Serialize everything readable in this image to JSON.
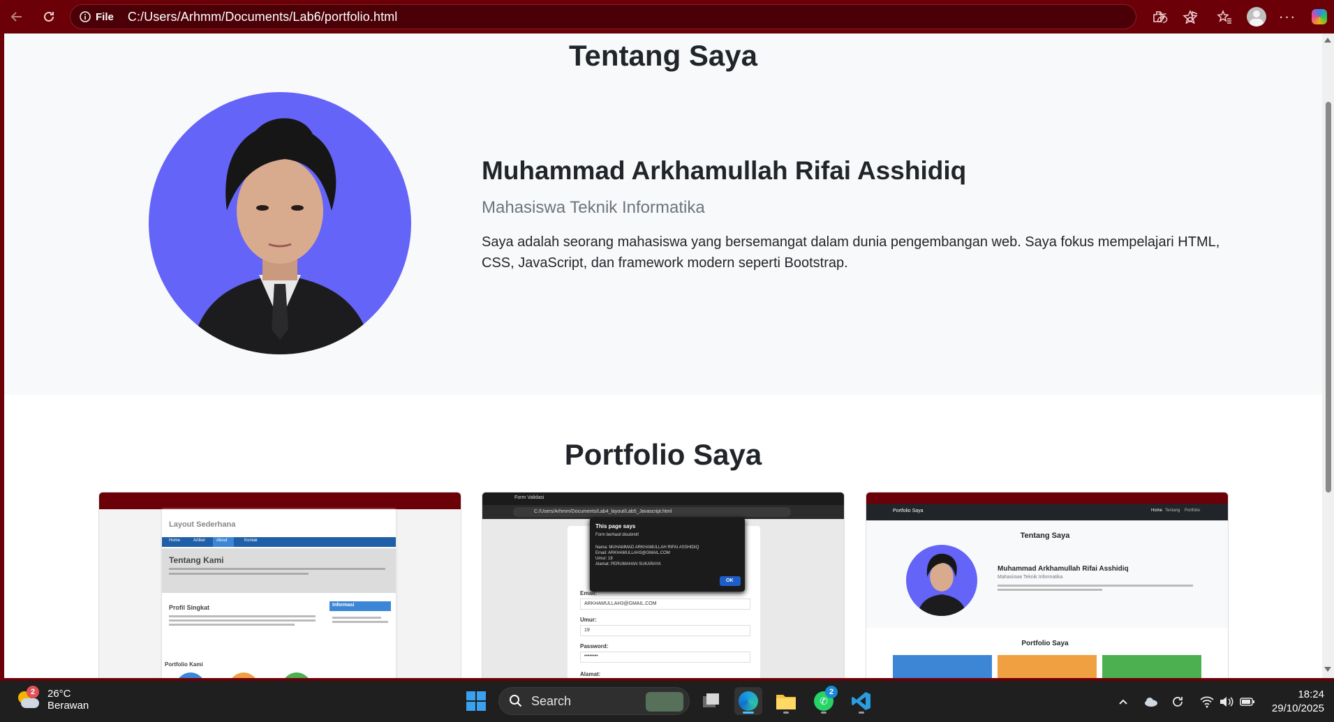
{
  "browser": {
    "site_info": "File",
    "url": "C:/Users/Arhmm/Documents/Lab6/portfolio.html"
  },
  "about": {
    "title": "Tentang Saya",
    "name": "Muhammad Arkhamullah Rifai Asshidiq",
    "role": "Mahasiswa Teknik Informatika",
    "description": "Saya adalah seorang mahasiswa yang bersemangat dalam dunia pengembangan web. Saya fokus mempelajari HTML, CSS, JavaScript, dan framework modern seperti Bootstrap."
  },
  "portfolio": {
    "title": "Portfolio Saya",
    "items": [
      {
        "heading": "Layout Sederhana",
        "nav": [
          "Home",
          "Artikel",
          "About",
          "Kontak"
        ],
        "section": "Tentang Kami",
        "profil": "Profil Singkat",
        "informasi": "Informasi",
        "portfolio": "Portfolio Kami"
      },
      {
        "tab": "Form Validasi",
        "url": "C:/Users/Arhmm/Documents/Lab4_layout/Lab5_Javascript.html",
        "dialog_title": "This page says",
        "dialog_lines": [
          "Form berhasil disubmit!",
          "Nama: MUHAMMAD ARKHAMULLAH RIFAI ASSHIDIQ",
          "Email: ARKHAMULLAH3@GMAIL.COM",
          "Umur: 19",
          "Alamat: PERUMAHAN SUKARAYA"
        ],
        "ok": "OK",
        "fields": [
          "Email:",
          "Umur:",
          "Password:",
          "Alamat:"
        ],
        "email_value": "ARKHAMULLAH3@GMAIL.COM",
        "umur_value": "19",
        "password_value": "••••••••"
      },
      {
        "brand": "Portfolio Saya",
        "nav": [
          "Home",
          "Tentang",
          "Portfolio"
        ],
        "about_title": "Tentang Saya",
        "name": "Muhammad Arkhamullah Rifai Asshidiq",
        "role": "Mahasiswa Teknik Informatika",
        "portfolio_title": "Portfolio Saya"
      }
    ]
  },
  "taskbar": {
    "temperature": "26°C",
    "weather": "Berawan",
    "weather_badge": "2",
    "search_label": "Search",
    "whatsapp_badge": "2",
    "time": "18:24",
    "date": "29/10/2025"
  }
}
